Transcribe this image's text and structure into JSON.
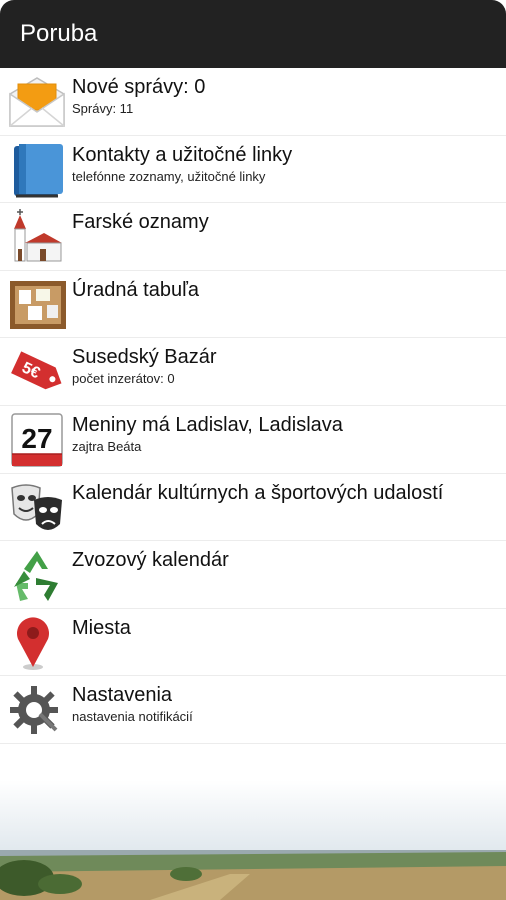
{
  "app": {
    "title": "Poruba"
  },
  "items": [
    {
      "label": "Nové správy: 0",
      "sub": "Správy: 11",
      "icon": "mail-envelope-icon"
    },
    {
      "label": "Kontakty a užitočné linky",
      "sub": "telefónne zoznamy, užitočné linky",
      "icon": "address-book-icon"
    },
    {
      "label": "Farské oznamy",
      "sub": "",
      "icon": "church-icon"
    },
    {
      "label": "Úradná tabuľa",
      "sub": "",
      "icon": "notice-board-icon"
    },
    {
      "label": "Susedský Bazár",
      "sub": "počet inzerátov: 0",
      "icon": "price-tag-icon",
      "tag_text": "5€"
    },
    {
      "label": "Meniny má Ladislav, Ladislava",
      "sub": "zajtra Beáta",
      "icon": "calendar-icon",
      "calendar_day": "27"
    },
    {
      "label": "Kalendár kultúrnych a športových udalostí",
      "sub": "",
      "icon": "theater-masks-icon"
    },
    {
      "label": "Zvozový kalendár",
      "sub": "",
      "icon": "recycle-icon"
    },
    {
      "label": "Miesta",
      "sub": "",
      "icon": "map-pin-icon"
    },
    {
      "label": "Nastavenia",
      "sub": "nastavenia notifikácií",
      "icon": "settings-gear-icon"
    }
  ],
  "colors": {
    "appbar": "#222222",
    "divider": "#ececec",
    "accent_red": "#d32f2f"
  }
}
